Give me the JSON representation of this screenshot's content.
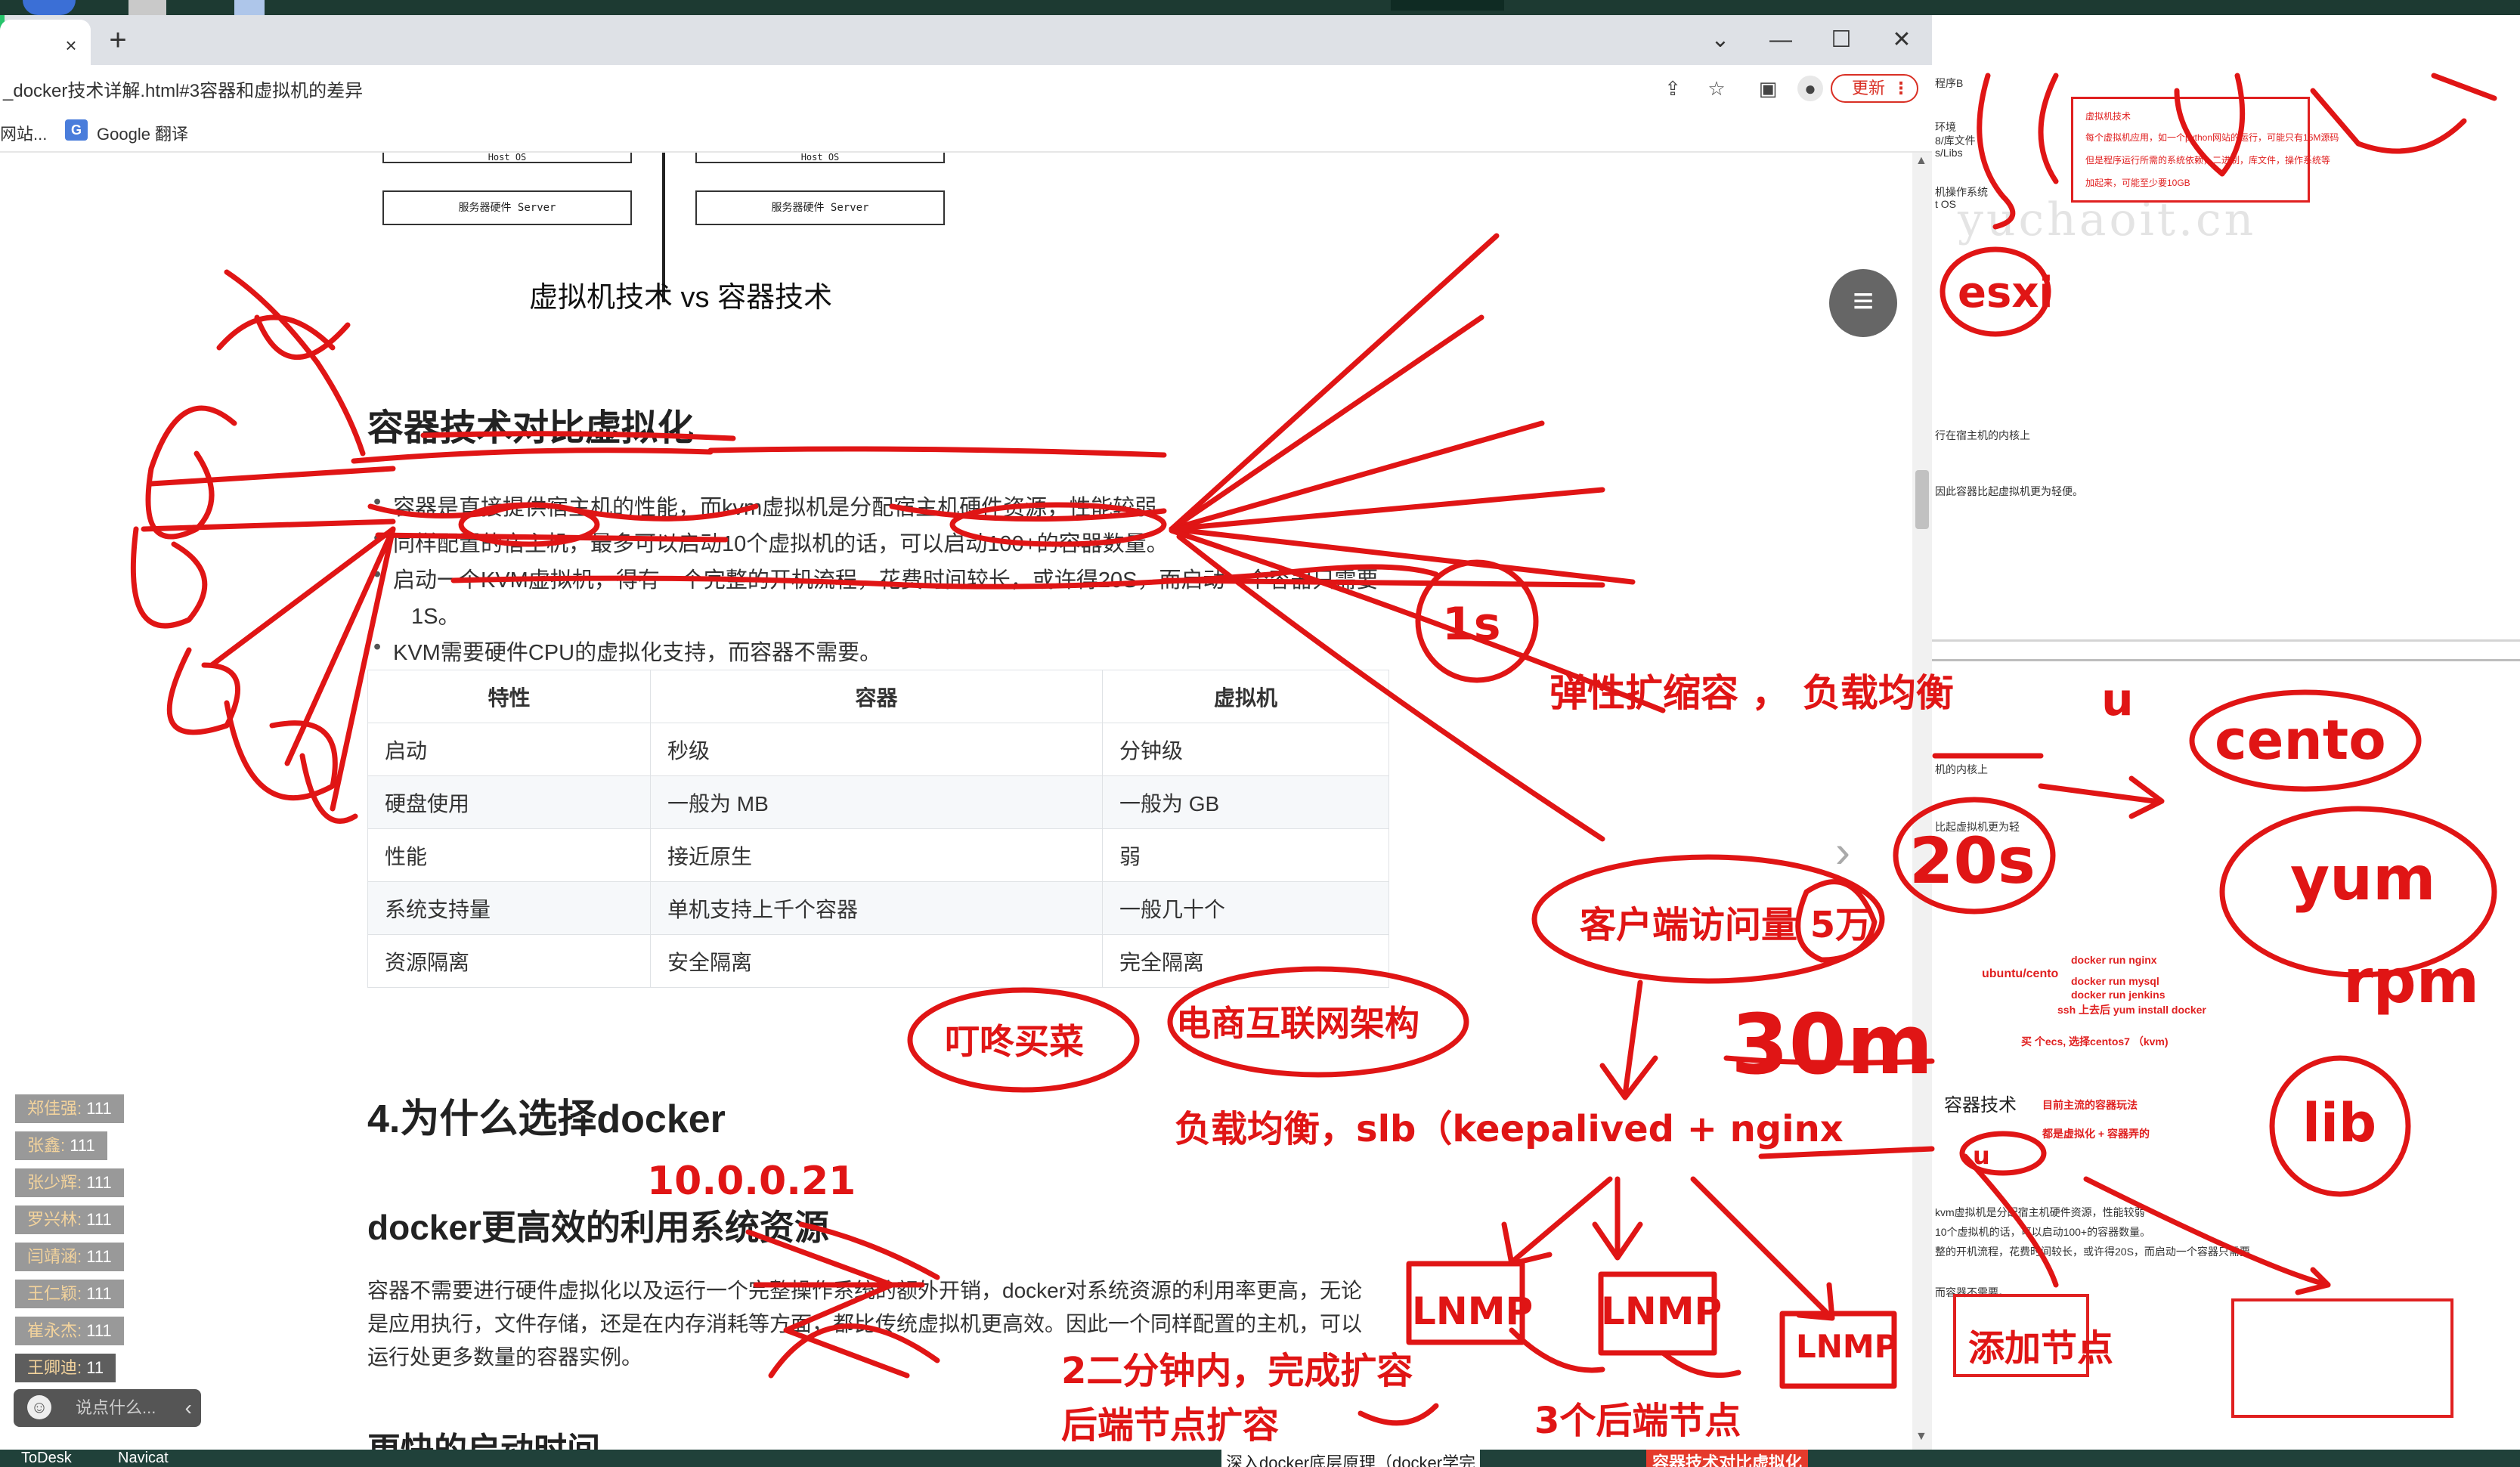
{
  "browser": {
    "tab_close": "×",
    "new_tab": "+",
    "url": "_docker技术详解.html#3容器和虚拟机的差异",
    "update_label": "更新",
    "bookmarks": {
      "item1": "网站...",
      "google_icon_text": "G",
      "google_translate": "Google 翻译"
    },
    "window_buttons": {
      "min": "—",
      "max": "☐",
      "close": "✕",
      "chevron": "⌄"
    }
  },
  "diagram": {
    "left_hostos": "Host OS",
    "left_server": "服务器硬件 Server",
    "right_hostos": "Host OS",
    "right_server": "服务器硬件 Server",
    "caption": "虚拟机技术 vs 容器技术"
  },
  "article": {
    "section_title": "容器技术对比虚拟化",
    "bullets": [
      "容器是直接提供宿主机的性能，而kvm虚拟机是分配宿主机硬件资源，性能较弱",
      "同样配置的宿主机，最多可以启动10个虚拟机的话，可以启动100+的容器数量。",
      "启动一个KVM虚拟机，得有一个完整的开机流程，花费时间较长，或许得20S，而启动一个容器只需要",
      "1S。",
      "KVM需要硬件CPU的虚拟化支持，而容器不需要。"
    ],
    "table": {
      "headers": [
        "特性",
        "容器",
        "虚拟机"
      ],
      "rows": [
        [
          "启动",
          "秒级",
          "分钟级"
        ],
        [
          "硬盘使用",
          "一般为 MB",
          "一般为 GB"
        ],
        [
          "性能",
          "接近原生",
          "弱"
        ],
        [
          "系统支持量",
          "单机支持上千个容器",
          "一般几十个"
        ],
        [
          "资源隔离",
          "安全隔离",
          "完全隔离"
        ]
      ]
    },
    "h4": "4.为什么选择docker",
    "h5": "docker更高效的利用系统资源",
    "paragraph": "容器不需要进行硬件虚拟化以及运行一个完整操作系统的额外开销，docker对系统资源的利用率更高，无论是应用执行，文件存储，还是在内存消耗等方面，都比传统虚拟机更高效。因此一个同样配置的主机，可以运行处更多数量的容器实例。",
    "next_heading": "更快的启动时间",
    "menu_icon": "≡",
    "next_icon": "›"
  },
  "chat": {
    "messages": [
      {
        "name": "郑佳强:",
        "count": "111"
      },
      {
        "name": "张鑫:",
        "count": "111"
      },
      {
        "name": "张少辉:",
        "count": "111"
      },
      {
        "name": "罗兴林:",
        "count": "111"
      },
      {
        "name": "闫靖涵:",
        "count": "111"
      },
      {
        "name": "王仁颖:",
        "count": "111"
      },
      {
        "name": "崔永杰:",
        "count": "111"
      },
      {
        "name": "王卿迪:",
        "count": "11"
      }
    ],
    "input_placeholder": "说点什么...",
    "emoji": "☺",
    "collapse": "‹"
  },
  "taskbar": {
    "todesk": "ToDesk",
    "navicat": "Navicat",
    "doc_title": "深入docker底层原理（docker学完",
    "red_title": "容器技术对比虚拟化"
  },
  "right_pane": {
    "watermark": "yuchaoit.cn",
    "red_box_title": "虚拟机技术",
    "red_box_line1": "每个虚拟机应用，如一个python网站的运行，可能只有16M源码",
    "red_box_line2": "但是程序运行所需的系统依赖，二进制，库文件，操作系统等",
    "red_box_line3": "加起来，可能至少要10GB",
    "small1": "程序B",
    "small2": "环境",
    "small3": "8/库文件",
    "small4": "s/Libs",
    "small5": "机操作系统",
    "small6": "t OS",
    "note1": "行在宿主机的内核上",
    "note2": "因此容器比起虚拟机更为轻便。",
    "note3": "机的内核上",
    "note4": "比起虚拟机更为轻",
    "docker_lines": [
      "docker run nginx",
      "docker run mysql",
      "docker run jenkins",
      "ssh 上去后 yum install docker",
      "买 个ecs, 选择centos7 （kvm)"
    ],
    "ubuntu": "ubuntu/cento",
    "container_tech": "容器技术",
    "mainstream": "目前主流的容器玩法",
    "both": "都是虚拟化 + 容器弄的",
    "bottom1": "kvm虚拟机是分配宿主机硬件资源，性能较弱",
    "bottom2": "10个虚拟机的话，可以启动100+的容器数量。",
    "bottom3": "整的开机流程，花费时间较长，或许得20S，而启动一个容器只需要",
    "bottom4": "而容器不需要。"
  },
  "annotations": {
    "elastic": "弹性扩缩容 ， 负载均衡",
    "client": "客户端访问量 5万",
    "ding": "叮咚买菜",
    "ecom": "电商互联网架构",
    "lb": "负载均衡，slb（keepalived + nginx",
    "ip": "10.0.0.21",
    "two_min": "2二分钟内，完成扩容",
    "backend": "后端节点扩容",
    "three": "3个后端节点",
    "add_node": "添加节点",
    "lnmp": "LNMP",
    "one_s": "1s",
    "twenty_s": "20s",
    "thirty_m": "30m",
    "u": "u",
    "esxi": "esxi",
    "centos": "cento",
    "yum": "yum",
    "rpm": "rpm",
    "lib": "lib",
    "u2": "u"
  },
  "colors": {
    "annotation_red": "#e01515",
    "update_red": "#d93025",
    "chat_name": "#f3d39c"
  }
}
